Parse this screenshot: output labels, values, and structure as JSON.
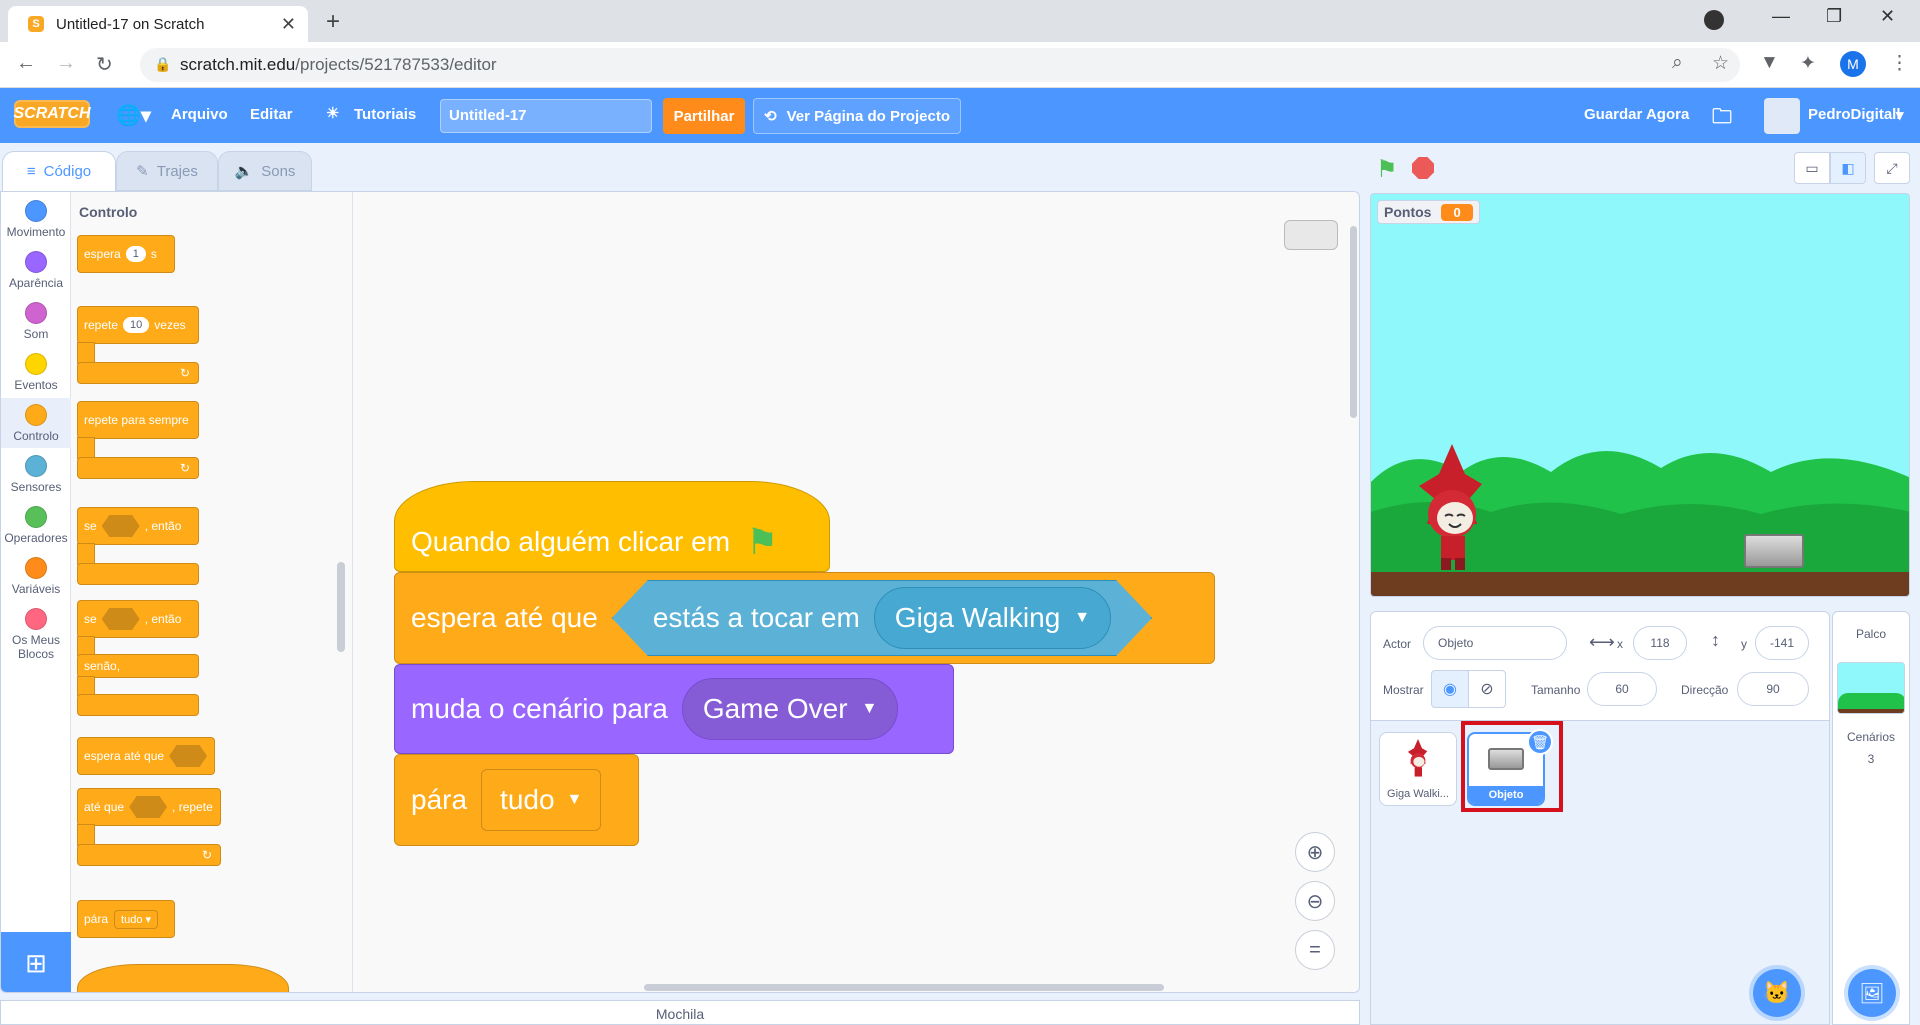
{
  "browser": {
    "tab_title": "Untitled-17 on Scratch",
    "url_host": "scratch.mit.edu",
    "url_path": "/projects/521787533/editor",
    "profile_initial": "M"
  },
  "menu": {
    "logo": "SCRATCH",
    "file": "Arquivo",
    "edit": "Editar",
    "tutorials": "Tutoriais",
    "project_title": "Untitled-17",
    "share": "Partilhar",
    "project_page": "Ver Página do Projecto",
    "save_now": "Guardar Agora",
    "username": "PedroDigitall"
  },
  "editor_tabs": {
    "code": "Código",
    "costumes": "Trajes",
    "sounds": "Sons"
  },
  "categories": [
    {
      "label": "Movimento",
      "color": "#4c97ff"
    },
    {
      "label": "Aparência",
      "color": "#9966ff"
    },
    {
      "label": "Som",
      "color": "#cf63cf"
    },
    {
      "label": "Eventos",
      "color": "#ffd500"
    },
    {
      "label": "Controlo",
      "color": "#ffab19"
    },
    {
      "label": "Sensores",
      "color": "#5cb1d6"
    },
    {
      "label": "Operadores",
      "color": "#59c059"
    },
    {
      "label": "Variáveis",
      "color": "#ff8c1a"
    },
    {
      "label": "Os Meus Blocos",
      "color": "#ff6680"
    }
  ],
  "palette": {
    "heading": "Controlo",
    "wait": "espera",
    "wait_value": "1",
    "wait_unit": "s",
    "repeat": "repete",
    "repeat_value": "10",
    "repeat_unit": "vezes",
    "forever": "repete para sempre",
    "if": "se",
    "then": ", então",
    "else": "senão,",
    "wait_until": "espera até que",
    "repeat_until": "até que",
    "repeat_until_suffix": ", repete",
    "stop": "pára",
    "stop_value": "tudo"
  },
  "script": {
    "hat": "Quando alguém clicar em",
    "wait_until": "espera até que",
    "touching": "estás a tocar em",
    "touching_target": "Giga Walking",
    "switch_backdrop": "muda o cenário para",
    "backdrop_value": "Game Over",
    "stop": "pára",
    "stop_value": "tudo"
  },
  "backpack": "Mochila",
  "stage": {
    "monitor_label": "Pontos",
    "monitor_value": "0"
  },
  "sprite_info": {
    "sprite_label": "Actor",
    "sprite_name": "Objeto",
    "x_label": "x",
    "x_value": "118",
    "y_label": "y",
    "y_value": "-141",
    "show_label": "Mostrar",
    "size_label": "Tamanho",
    "size_value": "60",
    "direction_label": "Direcção",
    "direction_value": "90"
  },
  "sprites": [
    {
      "name": "Giga Walki..."
    },
    {
      "name": "Objeto"
    }
  ],
  "backdrop_panel": {
    "title": "Palco",
    "label": "Cenários",
    "count": "3"
  }
}
